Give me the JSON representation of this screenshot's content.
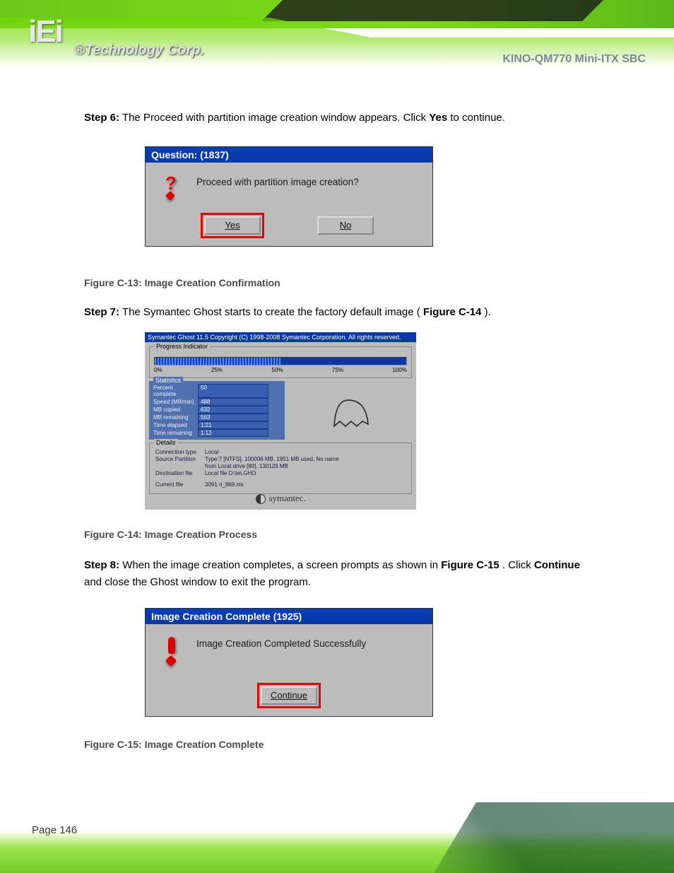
{
  "brand": {
    "logo": "iEi",
    "tagline": "®Technology Corp."
  },
  "product_title": "KINO-QM770 Mini-ITX SBC",
  "step6": {
    "prefix": "Step 6:",
    "text": "The Proceed with partition image creation window appears. Click",
    "action": "Yes",
    "after": "to continue."
  },
  "dialog1": {
    "title": "Question: (1837)",
    "message": "Proceed with partition image creation?",
    "yes": "Yes",
    "no": "No"
  },
  "caption1": "Figure C-13: Image Creation Confirmation",
  "step7": {
    "prefix": "Step 7:",
    "text": "The Symantec Ghost starts to create the factory default image (",
    "figref": "Figure C-14",
    "after": ")."
  },
  "ghost": {
    "title": "Symantec Ghost 11.5   Copyright (C) 1998-2008 Symantec Corporation. All rights reserved.",
    "progress_legend": "Progress Indicator",
    "ticks": [
      "0%",
      "25%",
      "50%",
      "75%",
      "100%"
    ],
    "percent_fill": 50,
    "stats_legend": "Statistics",
    "stats": {
      "percent_complete_lbl": "Percent complete",
      "percent_complete": "50",
      "speed_lbl": "Speed (MB/min)",
      "speed": "488",
      "mb_copied_lbl": "MB copied",
      "mb_copied": "632",
      "mb_remaining_lbl": "MB remaining",
      "mb_remaining": "563",
      "time_elapsed_lbl": "Time elapsed",
      "time_elapsed": "1:21",
      "time_remaining_lbl": "Time remaining",
      "time_remaining": "1:12"
    },
    "details_legend": "Details",
    "details": {
      "conn_lbl": "Connection type",
      "conn": "Local",
      "src_lbl": "Source Partition",
      "src": "Type:7 [NTFS], 100006 MB, 1951 MB used, No name",
      "src2": "from Local drive [80], 130129 MB",
      "dest_lbl": "Destination file",
      "dest": "Local file D:\\iei.GHO",
      "curr_lbl": "Current file",
      "curr": "3091 o_869.nls"
    },
    "footer": "symantec."
  },
  "caption2": "Figure C-14: Image Creation Process",
  "step8": {
    "prefix": "Step 8:",
    "text": "When the image creation completes, a screen prompts as shown in",
    "figref": "Figure C-15",
    "after1": ". Click",
    "action": "Continue",
    "after2": "and close the Ghost window to exit the program."
  },
  "dialog3": {
    "title": "Image Creation Complete (1925)",
    "message": "Image Creation Completed Successfully",
    "continue": "Continue"
  },
  "caption3": "Figure C-15: Image Creation Complete",
  "page_number": "Page 146"
}
